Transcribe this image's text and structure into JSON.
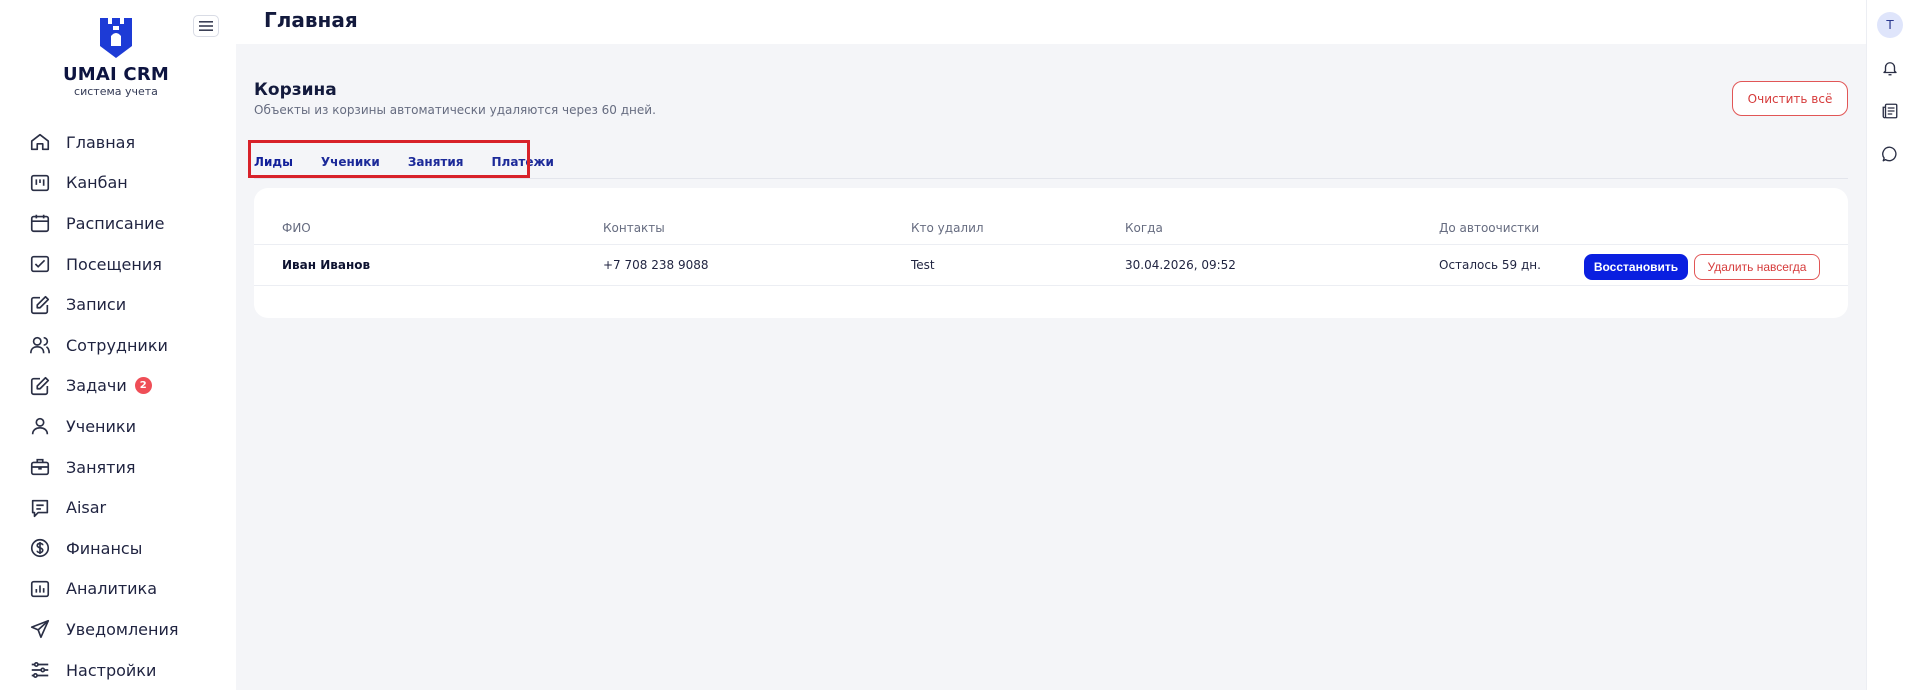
{
  "brand": {
    "title": "UMAI CRM",
    "subtitle": "система учета",
    "color": "#1d3bd6"
  },
  "sidebar": {
    "items": [
      {
        "label": "Главная",
        "icon": "home-icon"
      },
      {
        "label": "Канбан",
        "icon": "kanban-icon"
      },
      {
        "label": "Расписание",
        "icon": "calendar-icon"
      },
      {
        "label": "Посещения",
        "icon": "attendance-icon"
      },
      {
        "label": "Записи",
        "icon": "edit-icon"
      },
      {
        "label": "Сотрудники",
        "icon": "users-icon"
      },
      {
        "label": "Задачи",
        "icon": "tasks-icon",
        "badge": "2"
      },
      {
        "label": "Ученики",
        "icon": "user-icon"
      },
      {
        "label": "Занятия",
        "icon": "briefcase-icon"
      },
      {
        "label": "Aisar",
        "icon": "chat-lines-icon"
      },
      {
        "label": "Финансы",
        "icon": "dollar-icon"
      },
      {
        "label": "Аналитика",
        "icon": "bar-chart-icon"
      },
      {
        "label": "Уведомления",
        "icon": "send-icon"
      },
      {
        "label": "Настройки",
        "icon": "sliders-icon"
      }
    ]
  },
  "header": {
    "title": "Главная"
  },
  "trash": {
    "title": "Корзина",
    "subtitle": "Объекты из корзины автоматически удаляются через 60 дней.",
    "clear_all_label": "Очистить всё"
  },
  "tabs": [
    {
      "label": "Лиды",
      "active": true
    },
    {
      "label": "Ученики",
      "active": false
    },
    {
      "label": "Занятия",
      "active": false
    },
    {
      "label": "Платежи",
      "active": false
    }
  ],
  "table": {
    "columns": [
      "ФИО",
      "Контакты",
      "Кто удалил",
      "Когда",
      "До автоочистки"
    ],
    "rows": [
      {
        "name": "Иван Иванов",
        "contacts": "+7 708 238 9088",
        "deleted_by": "Test",
        "when": "30.04.2026, 09:52",
        "remaining": "Осталось 59 дн.",
        "restore_label": "Восстановить",
        "delete_label": "Удалить навсегда"
      }
    ]
  },
  "user": {
    "initial": "T"
  },
  "colors": {
    "accent": "#0a1fe0",
    "danger": "#e15656",
    "highlight": "#d8222a",
    "badge": "#ef4e57"
  }
}
